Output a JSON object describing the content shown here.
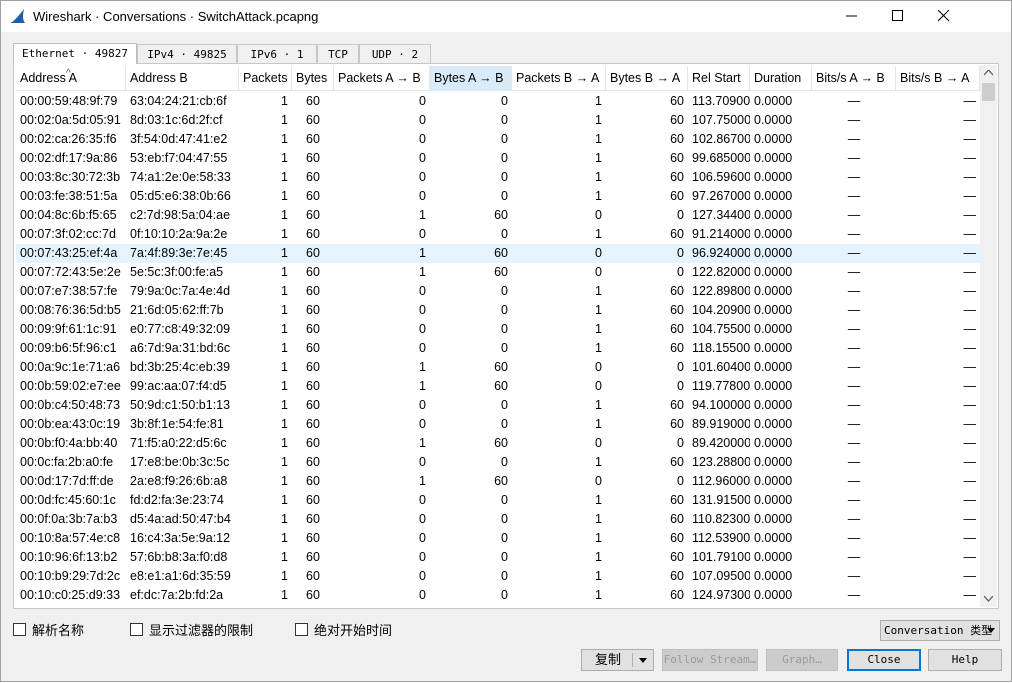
{
  "window": {
    "title": "Wireshark · Conversations · SwitchAttack.pcapng"
  },
  "tabs": [
    {
      "label": "Ethernet · 49827",
      "active": true
    },
    {
      "label": "IPv4 · 49825",
      "active": false
    },
    {
      "label": "IPv6 · 1",
      "active": false
    },
    {
      "label": "TCP",
      "active": false
    },
    {
      "label": "UDP · 2",
      "active": false
    }
  ],
  "table": {
    "columns": [
      "Address A",
      "Address B",
      "Packets",
      "Bytes",
      "Packets A → B",
      "Bytes A → B",
      "Packets B → A",
      "Bytes B → A",
      "Rel Start",
      "Duration",
      "Bits/s A → B",
      "Bits/s B → A"
    ],
    "sorted_column": "Bytes A → B",
    "selected_row": 8,
    "rows": [
      [
        "00:00:59:48:9f:79",
        "63:04:24:21:cb:6f",
        "1",
        "60",
        "0",
        "0",
        "1",
        "60",
        "113.709000",
        "0.0000",
        "—",
        "—"
      ],
      [
        "00:02:0a:5d:05:91",
        "8d:03:1c:6d:2f:cf",
        "1",
        "60",
        "0",
        "0",
        "1",
        "60",
        "107.750000",
        "0.0000",
        "—",
        "—"
      ],
      [
        "00:02:ca:26:35:f6",
        "3f:54:0d:47:41:e2",
        "1",
        "60",
        "0",
        "0",
        "1",
        "60",
        "102.867000",
        "0.0000",
        "—",
        "—"
      ],
      [
        "00:02:df:17:9a:86",
        "53:eb:f7:04:47:55",
        "1",
        "60",
        "0",
        "0",
        "1",
        "60",
        "99.685000",
        "0.0000",
        "—",
        "—"
      ],
      [
        "00:03:8c:30:72:3b",
        "74:a1:2e:0e:58:33",
        "1",
        "60",
        "0",
        "0",
        "1",
        "60",
        "106.596000",
        "0.0000",
        "—",
        "—"
      ],
      [
        "00:03:fe:38:51:5a",
        "05:d5:e6:38:0b:66",
        "1",
        "60",
        "0",
        "0",
        "1",
        "60",
        "97.267000",
        "0.0000",
        "—",
        "—"
      ],
      [
        "00:04:8c:6b:f5:65",
        "c2:7d:98:5a:04:ae",
        "1",
        "60",
        "1",
        "60",
        "0",
        "0",
        "127.344000",
        "0.0000",
        "—",
        "—"
      ],
      [
        "00:07:3f:02:cc:7d",
        "0f:10:10:2a:9a:2e",
        "1",
        "60",
        "0",
        "0",
        "1",
        "60",
        "91.214000",
        "0.0000",
        "—",
        "—"
      ],
      [
        "00:07:43:25:ef:4a",
        "7a:4f:89:3e:7e:45",
        "1",
        "60",
        "1",
        "60",
        "0",
        "0",
        "96.924000",
        "0.0000",
        "—",
        "—"
      ],
      [
        "00:07:72:43:5e:2e",
        "5e:5c:3f:00:fe:a5",
        "1",
        "60",
        "1",
        "60",
        "0",
        "0",
        "122.820000",
        "0.0000",
        "—",
        "—"
      ],
      [
        "00:07:e7:38:57:fe",
        "79:9a:0c:7a:4e:4d",
        "1",
        "60",
        "0",
        "0",
        "1",
        "60",
        "122.898000",
        "0.0000",
        "—",
        "—"
      ],
      [
        "00:08:76:36:5d:b5",
        "21:6d:05:62:ff:7b",
        "1",
        "60",
        "0",
        "0",
        "1",
        "60",
        "104.209000",
        "0.0000",
        "—",
        "—"
      ],
      [
        "00:09:9f:61:1c:91",
        "e0:77:c8:49:32:09",
        "1",
        "60",
        "0",
        "0",
        "1",
        "60",
        "104.755000",
        "0.0000",
        "—",
        "—"
      ],
      [
        "00:09:b6:5f:96:c1",
        "a6:7d:9a:31:bd:6c",
        "1",
        "60",
        "0",
        "0",
        "1",
        "60",
        "118.155000",
        "0.0000",
        "—",
        "—"
      ],
      [
        "00:0a:9c:1e:71:a6",
        "bd:3b:25:4c:eb:39",
        "1",
        "60",
        "1",
        "60",
        "0",
        "0",
        "101.604000",
        "0.0000",
        "—",
        "—"
      ],
      [
        "00:0b:59:02:e7:ee",
        "99:ac:aa:07:f4:d5",
        "1",
        "60",
        "1",
        "60",
        "0",
        "0",
        "119.778000",
        "0.0000",
        "—",
        "—"
      ],
      [
        "00:0b:c4:50:48:73",
        "50:9d:c1:50:b1:13",
        "1",
        "60",
        "0",
        "0",
        "1",
        "60",
        "94.100000",
        "0.0000",
        "—",
        "—"
      ],
      [
        "00:0b:ea:43:0c:19",
        "3b:8f:1e:54:fe:81",
        "1",
        "60",
        "0",
        "0",
        "1",
        "60",
        "89.919000",
        "0.0000",
        "—",
        "—"
      ],
      [
        "00:0b:f0:4a:bb:40",
        "71:f5:a0:22:d5:6c",
        "1",
        "60",
        "1",
        "60",
        "0",
        "0",
        "89.420000",
        "0.0000",
        "—",
        "—"
      ],
      [
        "00:0c:fa:2b:a0:fe",
        "17:e8:be:0b:3c:5c",
        "1",
        "60",
        "0",
        "0",
        "1",
        "60",
        "123.288000",
        "0.0000",
        "—",
        "—"
      ],
      [
        "00:0d:17:7d:ff:de",
        "2a:e8:f9:26:6b:a8",
        "1",
        "60",
        "1",
        "60",
        "0",
        "0",
        "112.960000",
        "0.0000",
        "—",
        "—"
      ],
      [
        "00:0d:fc:45:60:1c",
        "fd:d2:fa:3e:23:74",
        "1",
        "60",
        "0",
        "0",
        "1",
        "60",
        "131.915000",
        "0.0000",
        "—",
        "—"
      ],
      [
        "00:0f:0a:3b:7a:b3",
        "d5:4a:ad:50:47:b4",
        "1",
        "60",
        "0",
        "0",
        "1",
        "60",
        "110.823000",
        "0.0000",
        "—",
        "—"
      ],
      [
        "00:10:8a:57:4e:c8",
        "16:c4:3a:5e:9a:12",
        "1",
        "60",
        "0",
        "0",
        "1",
        "60",
        "112.539000",
        "0.0000",
        "—",
        "—"
      ],
      [
        "00:10:96:6f:13:b2",
        "57:6b:b8:3a:f0:d8",
        "1",
        "60",
        "0",
        "0",
        "1",
        "60",
        "101.791000",
        "0.0000",
        "—",
        "—"
      ],
      [
        "00:10:b9:29:7d:2c",
        "e8:e1:a1:6d:35:59",
        "1",
        "60",
        "0",
        "0",
        "1",
        "60",
        "107.095000",
        "0.0000",
        "—",
        "—"
      ],
      [
        "00:10:c0:25:d9:33",
        "ef:dc:7a:2b:fd:2a",
        "1",
        "60",
        "0",
        "0",
        "1",
        "60",
        "124.973000",
        "0.0000",
        "—",
        "—"
      ]
    ]
  },
  "options": {
    "resolve_names": "解析名称",
    "limit_to_filter": "显示过滤器的限制",
    "absolute_start_time": "绝对开始时间"
  },
  "conversation_type_label": "Conversation 类型",
  "buttons": {
    "copy": "复制",
    "follow_stream": "Follow Stream…",
    "graph": "Graph…",
    "close": "Close",
    "help": "Help"
  },
  "colors": {
    "selected_row": "#e5f3ff",
    "sorted_header": "#d9ebf9",
    "default_button_border": "#0078d7",
    "shark_fin": "#1f5fa8"
  }
}
